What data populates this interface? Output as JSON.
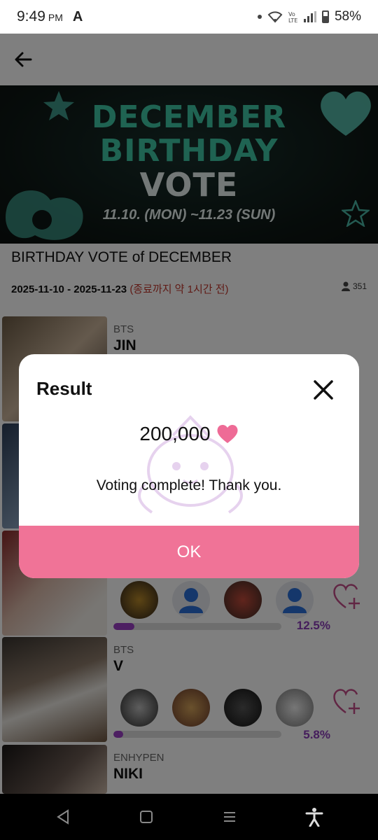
{
  "status_bar": {
    "time": "9:49",
    "ampm": "PM",
    "app_icon": "A",
    "battery": "58%"
  },
  "banner": {
    "line1": "DECEMBER",
    "line2": "BIRTHDAY",
    "line3": "VOTE",
    "dates": "11.10. (MON) ~11.23 (SUN)"
  },
  "vote": {
    "title": "BIRTHDAY VOTE of DECEMBER",
    "date_range": "2025-11-10 - 2025-11-23",
    "remaining": "(종료까지 약 1시간 전)",
    "participants": "351"
  },
  "candidates": [
    {
      "group": "BTS",
      "name": "JIN"
    },
    {
      "group": "",
      "name": "",
      "percent": "12.5%",
      "progress": 0.125
    },
    {
      "group": "BTS",
      "name": "V",
      "percent": "5.8%",
      "progress": 0.058
    },
    {
      "group": "ENHYPEN",
      "name": "NIKI"
    }
  ],
  "dialog": {
    "title": "Result",
    "amount": "200,000",
    "message": "Voting complete! Thank you.",
    "ok_label": "OK"
  },
  "colors": {
    "accent_pink": "#f07397",
    "heart": "#ee6b96",
    "progress_purple": "#9b3fc5",
    "percent_purple": "#8b3db8",
    "remaining_red": "#c0362c"
  }
}
